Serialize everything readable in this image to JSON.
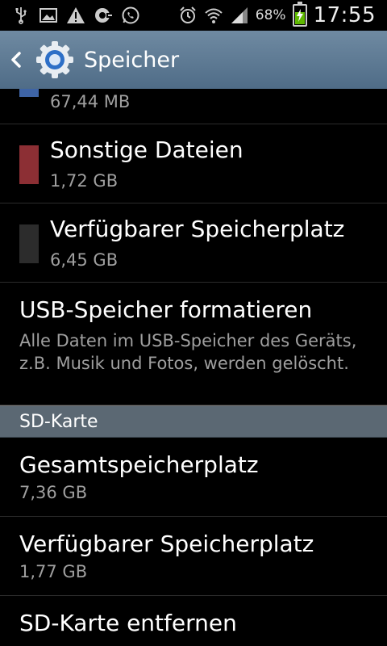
{
  "statusbar": {
    "battery_percent": "68%",
    "time": "17:55",
    "battery_level": 0.68,
    "battery_color": "#5fb800",
    "icons": [
      "usb-icon",
      "image-icon",
      "warning-icon",
      "voicemail-icon",
      "whatsapp-icon",
      "alarm-icon",
      "wifi-icon",
      "signal-icon",
      "battery-icon"
    ]
  },
  "actionbar": {
    "title": "Speicher",
    "back_icon": "chevron-left-icon",
    "app_icon": "gear-icon",
    "colors": {
      "top": "#6f8aa2",
      "bottom": "#4f6c87"
    }
  },
  "items": [
    {
      "subtitle": "67,44 MB",
      "swatch_color": "#3e64a6"
    },
    {
      "title": "Sonstige Dateien",
      "subtitle": "1,72 GB",
      "swatch_color": "#8c2f34"
    },
    {
      "title": "Verfügbarer Speicherplatz",
      "subtitle": "6,45 GB",
      "swatch_color": "#2c2c2c"
    },
    {
      "title": "USB-Speicher formatieren",
      "description": "Alle Daten im USB-Speicher des Geräts, z.B. Musik und Fotos, werden gelöscht."
    }
  ],
  "sd_section": {
    "header": "SD-Karte",
    "items": [
      {
        "title": "Gesamtspeicherplatz",
        "subtitle": "7,36 GB"
      },
      {
        "title": "Verfügbarer Speicherplatz",
        "subtitle": "1,77 GB"
      },
      {
        "title": "SD-Karte entfernen"
      }
    ]
  }
}
